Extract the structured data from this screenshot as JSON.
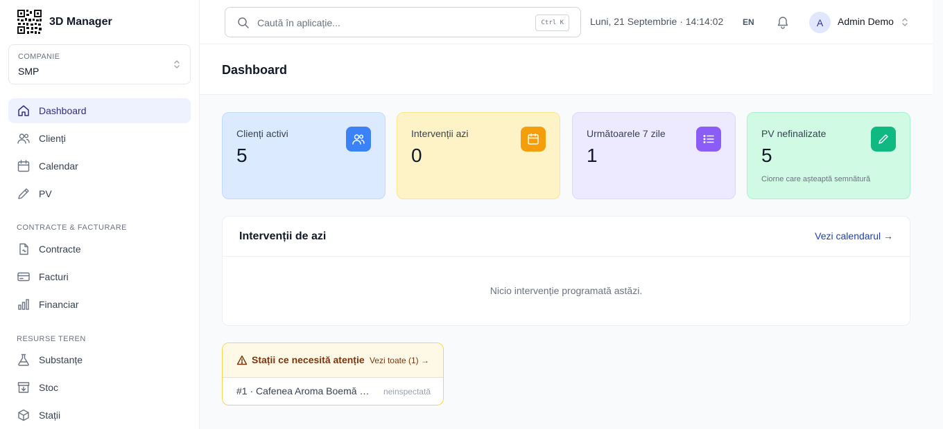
{
  "brand": {
    "name": "3D Manager",
    "logo_icon": "qr-code-icon"
  },
  "company": {
    "label": "COMPANIE",
    "value": "SMP"
  },
  "sidebar": {
    "items": [
      {
        "label": "Dashboard",
        "icon": "home-icon",
        "active": true
      },
      {
        "label": "Clienți",
        "icon": "users-icon"
      },
      {
        "label": "Calendar",
        "icon": "calendar-icon"
      },
      {
        "label": "PV",
        "icon": "pencil-icon"
      }
    ],
    "sections": [
      {
        "title": "CONTRACTE & FACTURARE",
        "items": [
          {
            "label": "Contracte",
            "icon": "contract-icon"
          },
          {
            "label": "Facturi",
            "icon": "credit-card-icon"
          },
          {
            "label": "Financiar",
            "icon": "bar-chart-icon"
          }
        ]
      },
      {
        "title": "RESURSE TEREN",
        "items": [
          {
            "label": "Substanțe",
            "icon": "flask-icon"
          },
          {
            "label": "Stoc",
            "icon": "archive-icon"
          },
          {
            "label": "Stații",
            "icon": "cube-icon"
          }
        ]
      }
    ]
  },
  "topbar": {
    "search_placeholder": "Caută în aplicație...",
    "shortcut": "Ctrl K",
    "datetime": "Luni, 21 Septembrie · 14:14:02",
    "language": "EN",
    "user": {
      "initial": "A",
      "name": "Admin Demo"
    }
  },
  "page": {
    "title": "Dashboard"
  },
  "stats": [
    {
      "label": "Clienți activi",
      "value": "5",
      "icon": "users-icon",
      "bg": "#dbeafe",
      "border": "#bfdbfe",
      "accent": "#3b82f6"
    },
    {
      "label": "Intervenții azi",
      "value": "0",
      "icon": "calendar-icon",
      "bg": "#fef3c7",
      "border": "#fde68a",
      "accent": "#f59e0b"
    },
    {
      "label": "Următoarele 7 zile",
      "value": "1",
      "icon": "list-icon",
      "bg": "#ede9fe",
      "border": "#ddd6fe",
      "accent": "#8b5cf6"
    },
    {
      "label": "PV nefinalizate",
      "value": "5",
      "sub": "Ciorne care așteaptă semnătură",
      "icon": "pencil-icon",
      "bg": "#d1fae5",
      "border": "#a7f3d0",
      "accent": "#10b981"
    }
  ],
  "today": {
    "title": "Intervenții de azi",
    "link": "Vezi calendarul →",
    "empty": "Nicio intervenție programată astăzi."
  },
  "alerts": {
    "title": "Stații ce necesită atenție",
    "link": "Vezi toate (1) →",
    "items": [
      {
        "label": "#1 · Cafenea Aroma Boemă S...",
        "status": "neinspectată"
      }
    ]
  }
}
